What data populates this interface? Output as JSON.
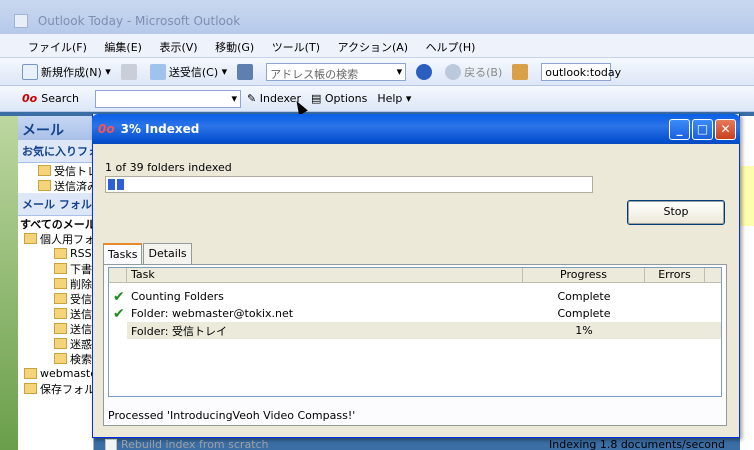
{
  "outlook": {
    "title": "Outlook Today - Microsoft Outlook",
    "menu": [
      "ファイル(F)",
      "編集(E)",
      "表示(V)",
      "移動(G)",
      "ツール(T)",
      "アクション(A)",
      "ヘルプ(H)"
    ],
    "toolbar": {
      "new_label": "新規作成(N)",
      "sendrecv_label": "送受信(C)",
      "address_placeholder": "アドレス帳の検索",
      "back_label": "戻る(B)",
      "url_value": "outlook:today"
    },
    "searchbar": {
      "search_label": "Search",
      "indexer_label": "Indexer",
      "options_label": "Options",
      "help_label": "Help"
    },
    "nav": {
      "header": "メール",
      "favorites_header": "お気に入りフォルダ",
      "favorites": [
        "受信トレイ",
        "送信済みアイテム"
      ],
      "mail_folders_header": "メール フォルダ",
      "all_mail": "すべてのメール",
      "tree": [
        "個人用フォルダ",
        "RSS",
        "下書き",
        "削除済み",
        "受信",
        "送信",
        "送信",
        "迷惑",
        "検索",
        "webmaster",
        "保存フォルダ"
      ]
    }
  },
  "dialog": {
    "title": "3% Indexed",
    "status_text": "1 of 39 folders indexed",
    "progress": 0.03,
    "stop_label": "Stop",
    "tabs": [
      "Tasks",
      "Details"
    ],
    "columns": {
      "task": "Task",
      "progress": "Progress",
      "errors": "Errors"
    },
    "rows": [
      {
        "task": "Counting Folders",
        "progress": "Complete",
        "errors": "",
        "done": true
      },
      {
        "task": "Folder: webmaster@tokix.net",
        "progress": "Complete",
        "errors": "",
        "done": true
      },
      {
        "task": "Folder: 受信トレイ",
        "progress": "1%",
        "errors": "",
        "done": false
      }
    ],
    "processed_text": "Processed 'IntroducingVeoh Video Compass!'",
    "rebuild_label": "Rebuild index from scratch",
    "rate_text": "Indexing 1.8 documents/second"
  }
}
